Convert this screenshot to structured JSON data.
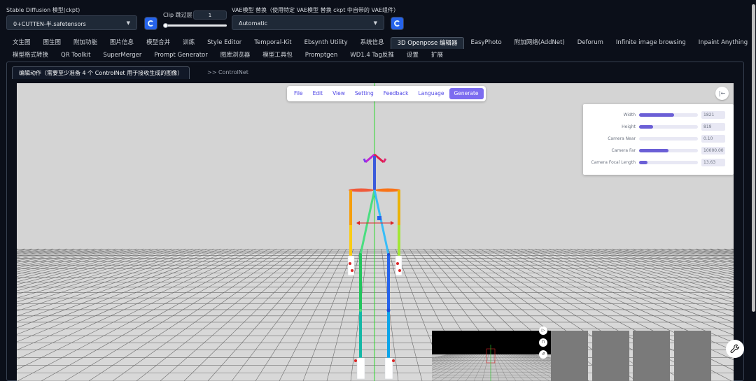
{
  "model": {
    "label": "Stable Diffusion 模型(ckpt)",
    "value": "0+CUTTEN-半.safetensors"
  },
  "clip": {
    "label": "Clip 跳过层",
    "value": "1",
    "fraction": 0
  },
  "vae": {
    "label": "VAE模型 替换（使用特定 VAE模型 替换 ckpt 中自带的 VAE组件）",
    "value": "Automatic"
  },
  "tabs_row1": [
    "文生图",
    "图生图",
    "附加功能",
    "图片信息",
    "模型合并",
    "训练",
    "Style Editor",
    "Temporal-Kit",
    "Ebsynth Utility",
    "系统信息",
    "3D Openpose 编辑器",
    "EasyPhoto",
    "附加网络(AddNet)",
    "Deforum",
    "Infinite image browsing",
    "Inpaint Anything"
  ],
  "tabs_row2": [
    "模型格式转换",
    "QR Toolkit",
    "SuperMerger",
    "Prompt Generator",
    "图库浏览器",
    "模型工具包",
    "Promptgen",
    "WD1.4 Tag反推",
    "设置",
    "扩展"
  ],
  "active_tab": "3D Openpose 编辑器",
  "subtabs": {
    "edit": "编辑动作（需要至少准备 4 个 ControlNet 用于接收生成的图像）",
    "controlnet": ">> ControlNet"
  },
  "editor_menu": [
    "File",
    "Edit",
    "View",
    "Setting",
    "Feedback",
    "Language",
    "Generate"
  ],
  "settings": [
    {
      "label": "Width",
      "value": "1821",
      "fraction": 0.6
    },
    {
      "label": "Height",
      "value": "819",
      "fraction": 0.24
    },
    {
      "label": "Camera Near",
      "value": "0.10",
      "fraction": 0
    },
    {
      "label": "Camera Far",
      "value": "10000.00",
      "fraction": 0.5
    },
    {
      "label": "Camera Focal Length",
      "value": "13.63",
      "fraction": 0.14
    }
  ],
  "colors": {
    "background": "#0b0f19",
    "accent": "#2563eb",
    "generate": "#7c6cf0",
    "slider_fill": "#6b5fd6"
  }
}
